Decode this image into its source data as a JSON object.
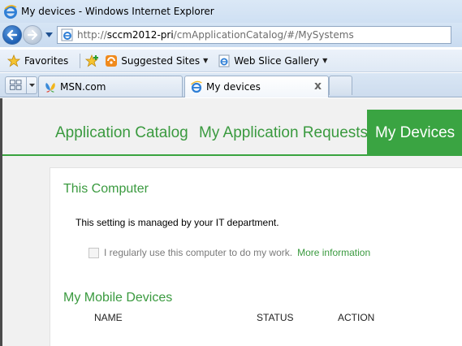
{
  "window": {
    "title": "My devices - Windows Internet Explorer"
  },
  "navigation": {
    "url_prefix": "http://",
    "url_host": "sccm2012-pri",
    "url_path": "/cmApplicationCatalog/#/MySystems"
  },
  "favorites_bar": {
    "favorites_label": "Favorites",
    "suggested_sites_label": "Suggested Sites",
    "web_slice_gallery_label": "Web Slice Gallery"
  },
  "tabs": [
    {
      "label": "MSN.com",
      "active": false
    },
    {
      "label": "My devices",
      "active": true,
      "close_glyph": "x"
    }
  ],
  "app_nav": {
    "items": [
      {
        "label": "Application Catalog",
        "active": false
      },
      {
        "label": "My Application Requests",
        "active": false
      },
      {
        "label": "My Devices",
        "active": true
      }
    ],
    "accent_color": "#3aa442"
  },
  "this_computer": {
    "title": "This Computer",
    "managed_text": "This setting is managed by your IT department.",
    "checkbox_label": "I regularly use this computer to do my work.",
    "checkbox_checked": false,
    "more_info_link": "More information"
  },
  "mobile_devices": {
    "title": "My Mobile Devices",
    "columns": [
      "NAME",
      "STATUS",
      "ACTION"
    ]
  }
}
